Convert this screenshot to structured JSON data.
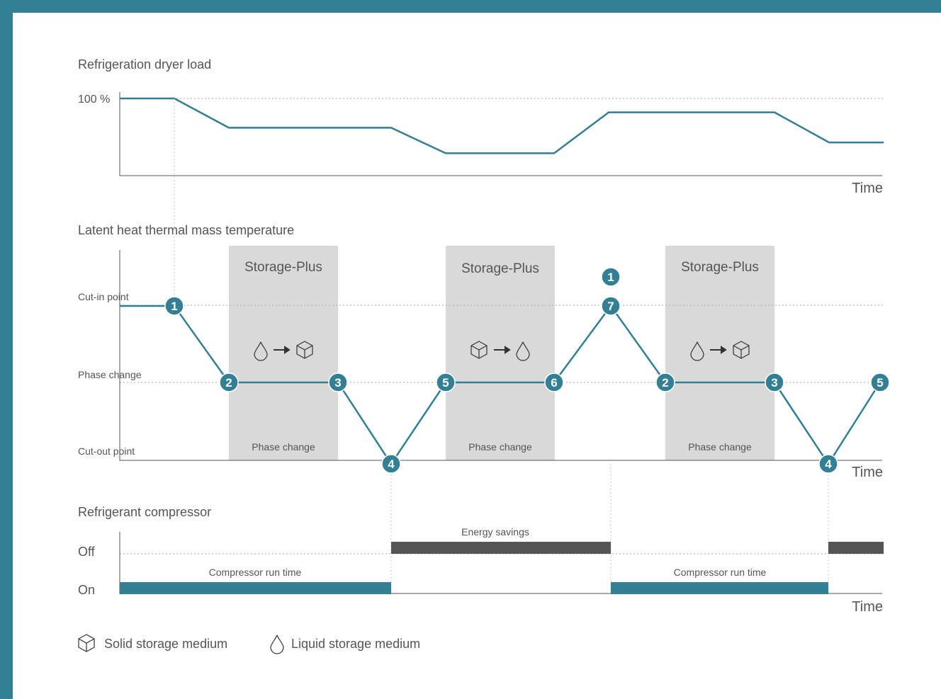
{
  "colors": {
    "accent": "#337f93",
    "band": "#d9d9d9",
    "bar_off": "#555555",
    "text": "#555555"
  },
  "panels": {
    "load": {
      "title": "Refrigeration dryer load",
      "y_label": "100 %",
      "x_label": "Time"
    },
    "temperature": {
      "title": "Latent heat thermal mass temperature",
      "levels": [
        "Cut-in point",
        "Phase change",
        "Cut-out point"
      ],
      "x_label": "Time",
      "bands": [
        {
          "title": "Storage-Plus",
          "subtitle": "Phase change",
          "transition": "liquid-to-solid"
        },
        {
          "title": "Storage-Plus",
          "subtitle": "Phase change",
          "transition": "solid-to-liquid"
        },
        {
          "title": "Storage-Plus",
          "subtitle": "Phase change",
          "transition": "liquid-to-solid"
        }
      ]
    },
    "compressor": {
      "title": "Refrigerant compressor",
      "off_label": "Off",
      "on_label": "On",
      "x_label": "Time",
      "bars": [
        {
          "state": "on",
          "label": "Compressor run time"
        },
        {
          "state": "off",
          "label": "Energy savings"
        },
        {
          "state": "on",
          "label": "Compressor run time"
        },
        {
          "state": "off",
          "label": ""
        }
      ]
    }
  },
  "markers": [
    "1",
    "2",
    "3",
    "4",
    "5",
    "6",
    "7",
    "1",
    "2",
    "3",
    "4",
    "5"
  ],
  "legend": {
    "solid": {
      "icon": "cube-icon",
      "label": "Solid storage medium"
    },
    "liquid": {
      "icon": "droplet-icon",
      "label": "Liquid storage medium"
    }
  },
  "chart_data": [
    {
      "type": "line",
      "title": "Refrigration dryer load",
      "ylabel": "",
      "xlabel": "Time",
      "y_unit": "% of full load",
      "series": [
        {
          "values": [
            100,
            100,
            62,
            62,
            29,
            29,
            82,
            82,
            43,
            43
          ]
        }
      ]
    },
    {
      "type": "line",
      "title": "Latent heat thermal mass temperature",
      "xlabel": "Time",
      "y_levels": [
        "Cut-out point",
        "Phase change",
        "Cut-in point"
      ],
      "series": [
        {
          "values": [
            "Cut-in point",
            "Cut-in point",
            "Phase change",
            "Phase change",
            "Cut-out point",
            "Phase change",
            "Phase change",
            "Cut-in point",
            "Phase change",
            "Phase change",
            "Cut-out point",
            "Phase change"
          ]
        }
      ]
    },
    {
      "type": "bar",
      "title": "Refrigerant compressor",
      "xlabel": "Time",
      "states": [
        "On",
        "Off",
        "On",
        "Off"
      ]
    }
  ]
}
